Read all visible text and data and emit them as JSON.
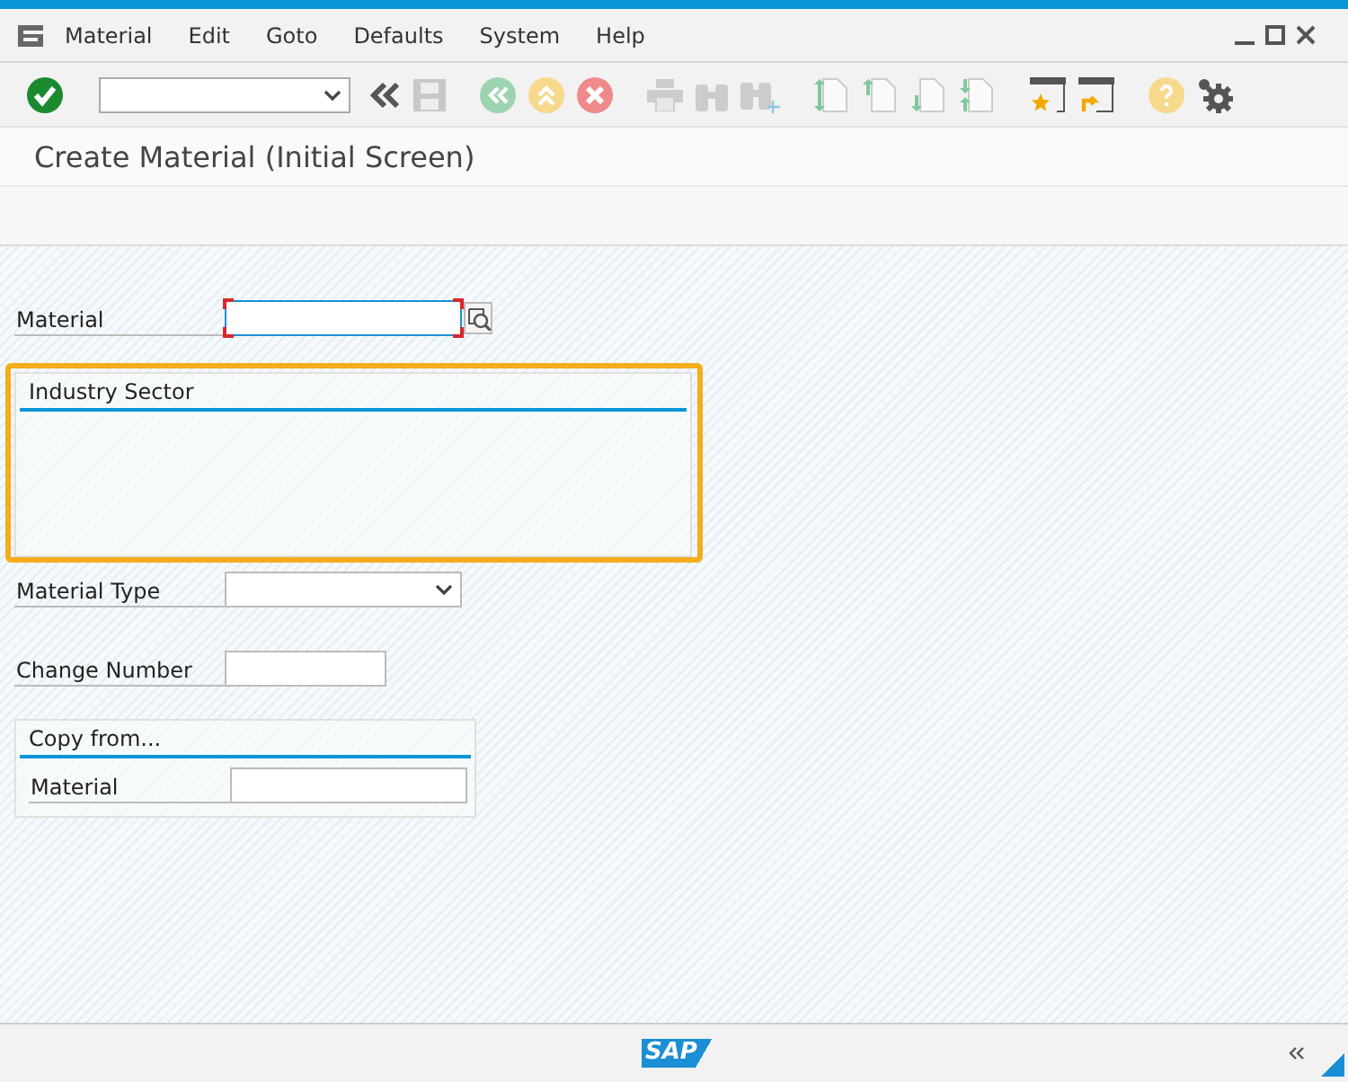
{
  "menu_bar": {
    "items": [
      {
        "label": "Material"
      },
      {
        "label": "Edit"
      },
      {
        "label": "Goto"
      },
      {
        "label": "Defaults"
      },
      {
        "label": "System"
      },
      {
        "label": "Help"
      }
    ]
  },
  "screen_title": "Create Material (Initial Screen)",
  "form": [
    {
      "kind": "input",
      "label": "Material",
      "required": true,
      "focused": true,
      "search_help": true
    },
    {
      "kind": "group",
      "title": "Industry Sector",
      "highlighted": true
    },
    {
      "kind": "dropdown",
      "label": "Material Type"
    },
    {
      "kind": "short_input",
      "label": "Change Number"
    },
    {
      "kind": "group",
      "title": "Copy from...",
      "highlighted": false,
      "fields": [
        {
          "kind": "input",
          "label": "Material"
        }
      ]
    }
  ],
  "status_bar": {
    "logo": "SAP"
  }
}
